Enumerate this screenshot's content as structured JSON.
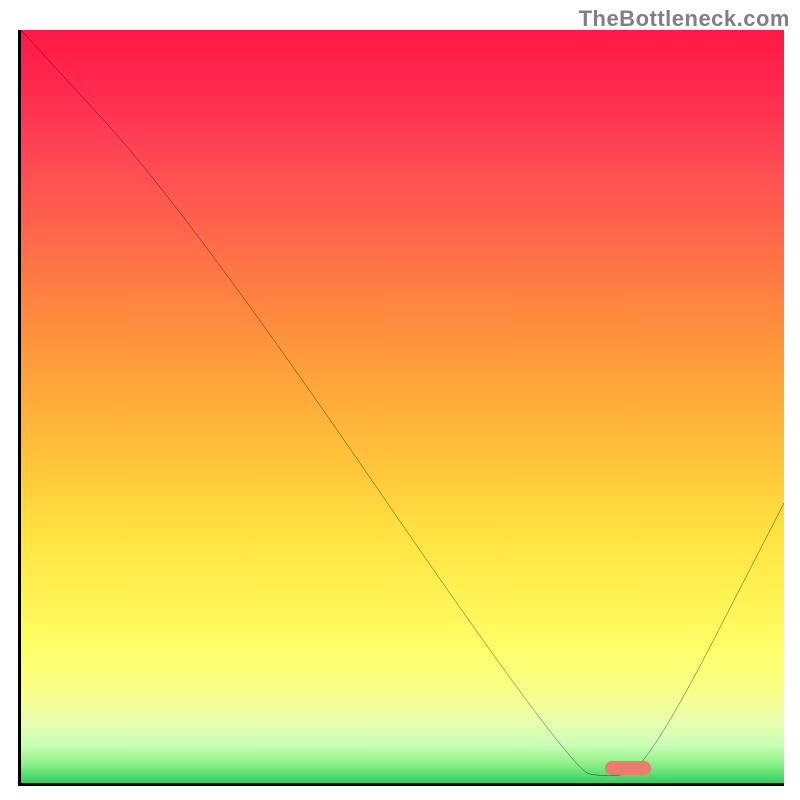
{
  "watermark": "TheBottleneck.com",
  "chart_data": {
    "type": "line",
    "title": "",
    "xlabel": "",
    "ylabel": "",
    "xlim": [
      0,
      100
    ],
    "ylim": [
      0,
      100
    ],
    "grid": false,
    "series": [
      {
        "name": "curve",
        "x": [
          0,
          22,
          72,
          77,
          82,
          100
        ],
        "values": [
          100,
          76,
          3,
          2,
          3,
          38
        ]
      }
    ],
    "marker": {
      "x": 79.5,
      "y": 2
    },
    "gradient_stops": [
      {
        "pct": 0,
        "color": "#ff1844"
      },
      {
        "pct": 8,
        "color": "#ff2a4f"
      },
      {
        "pct": 16,
        "color": "#ff4455"
      },
      {
        "pct": 28,
        "color": "#ff6a4a"
      },
      {
        "pct": 38,
        "color": "#ff8a3e"
      },
      {
        "pct": 48,
        "color": "#ffa83a"
      },
      {
        "pct": 58,
        "color": "#ffc53a"
      },
      {
        "pct": 66,
        "color": "#ffe040"
      },
      {
        "pct": 74,
        "color": "#fff050"
      },
      {
        "pct": 82,
        "color": "#feff68"
      },
      {
        "pct": 88,
        "color": "#f8ff8a"
      },
      {
        "pct": 92,
        "color": "#e8ffb0"
      },
      {
        "pct": 95,
        "color": "#c8ffb6"
      },
      {
        "pct": 97.5,
        "color": "#8cf086"
      },
      {
        "pct": 100,
        "color": "#30d060"
      }
    ]
  }
}
